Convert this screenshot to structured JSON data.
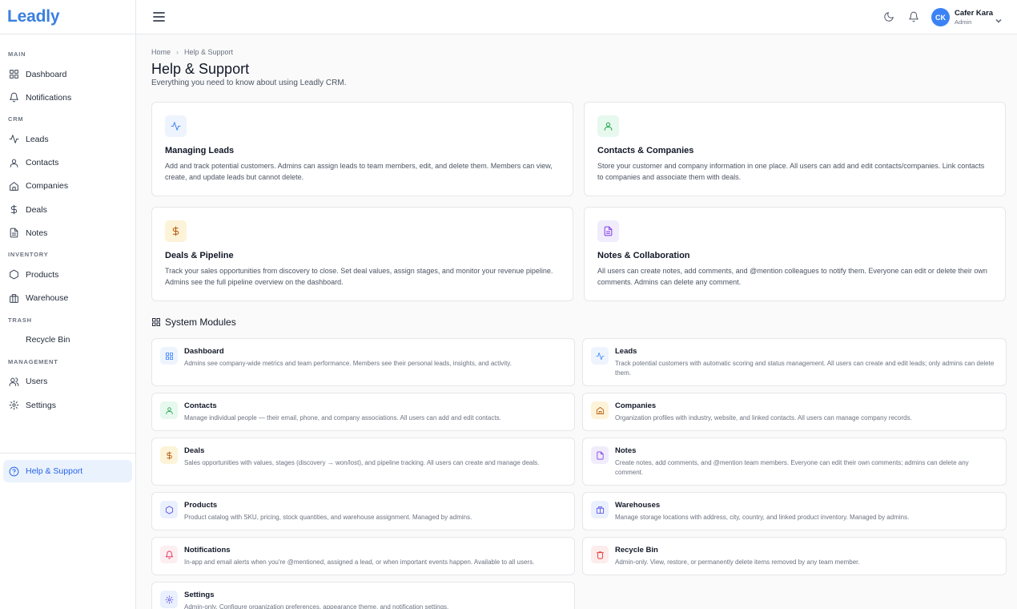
{
  "app": {
    "logo": "Leadly"
  },
  "sidebar": {
    "sections": {
      "main": "MAIN",
      "crm": "CRM",
      "inventory": "INVENTORY",
      "trash": "TRASH",
      "management": "MANAGEMENT"
    },
    "items": {
      "dashboard": "Dashboard",
      "notifications": "Notifications",
      "leads": "Leads",
      "contacts": "Contacts",
      "companies": "Companies",
      "deals": "Deals",
      "notes": "Notes",
      "products": "Products",
      "warehouse": "Warehouse",
      "recycle_bin": "Recycle Bin",
      "users": "Users",
      "settings": "Settings",
      "help": "Help & Support"
    }
  },
  "user": {
    "initials": "CK",
    "name": "Cafer Kara",
    "role": "Admin"
  },
  "breadcrumb": {
    "home": "Home",
    "current": "Help & Support"
  },
  "page": {
    "title": "Help & Support",
    "subtitle": "Everything you need to know about using Leadly CRM."
  },
  "cards": [
    {
      "title": "Managing Leads",
      "desc": "Add and track potential customers. Admins can assign leads to team members, edit, and delete them. Members can view, create, and update leads but cannot delete.",
      "icon": "activity-icon"
    },
    {
      "title": "Contacts & Companies",
      "desc": "Store your customer and company information in one place. All users can add and edit contacts/companies. Link contacts to companies and associate them with deals.",
      "icon": "user-icon"
    },
    {
      "title": "Deals & Pipeline",
      "desc": "Track your sales opportunities from discovery to close. Set deal values, assign stages, and monitor your revenue pipeline. Admins see the full pipeline overview on the dashboard.",
      "icon": "dollar-icon"
    },
    {
      "title": "Notes & Collaboration",
      "desc": "All users can create notes, add comments, and @mention colleagues to notify them. Everyone can edit or delete their own comments. Admins can delete any comment.",
      "icon": "file-icon"
    }
  ],
  "modules_heading": "System Modules",
  "modules": [
    {
      "title": "Dashboard",
      "desc": "Admins see company-wide metrics and team performance. Members see their personal leads, insights, and activity."
    },
    {
      "title": "Leads",
      "desc": "Track potential customers with automatic scoring and status management. All users can create and edit leads; only admins can delete them."
    },
    {
      "title": "Contacts",
      "desc": "Manage individual people — their email, phone, and company associations. All users can add and edit contacts."
    },
    {
      "title": "Companies",
      "desc": "Organization profiles with industry, website, and linked contacts. All users can manage company records."
    },
    {
      "title": "Deals",
      "desc": "Sales opportunities with values, stages (discovery → won/lost), and pipeline tracking. All users can create and manage deals."
    },
    {
      "title": "Notes",
      "desc": "Create notes, add comments, and @mention team members. Everyone can edit their own comments; admins can delete any comment."
    },
    {
      "title": "Products",
      "desc": "Product catalog with SKU, pricing, stock quantities, and warehouse assignment. Managed by admins."
    },
    {
      "title": "Warehouses",
      "desc": "Manage storage locations with address, city, country, and linked product inventory. Managed by admins."
    },
    {
      "title": "Notifications",
      "desc": "In-app and email alerts when you're @mentioned, assigned a lead, or when important events happen. Available to all users."
    },
    {
      "title": "Recycle Bin",
      "desc": "Admin-only. View, restore, or permanently delete items removed by any team member."
    },
    {
      "title": "Settings",
      "desc": "Admin-only. Configure organization preferences, appearance theme, and notification settings."
    }
  ],
  "colors": {
    "brand": "#3b7fe0",
    "active_bg": "#eaf2fd",
    "active_text": "#2563eb"
  }
}
